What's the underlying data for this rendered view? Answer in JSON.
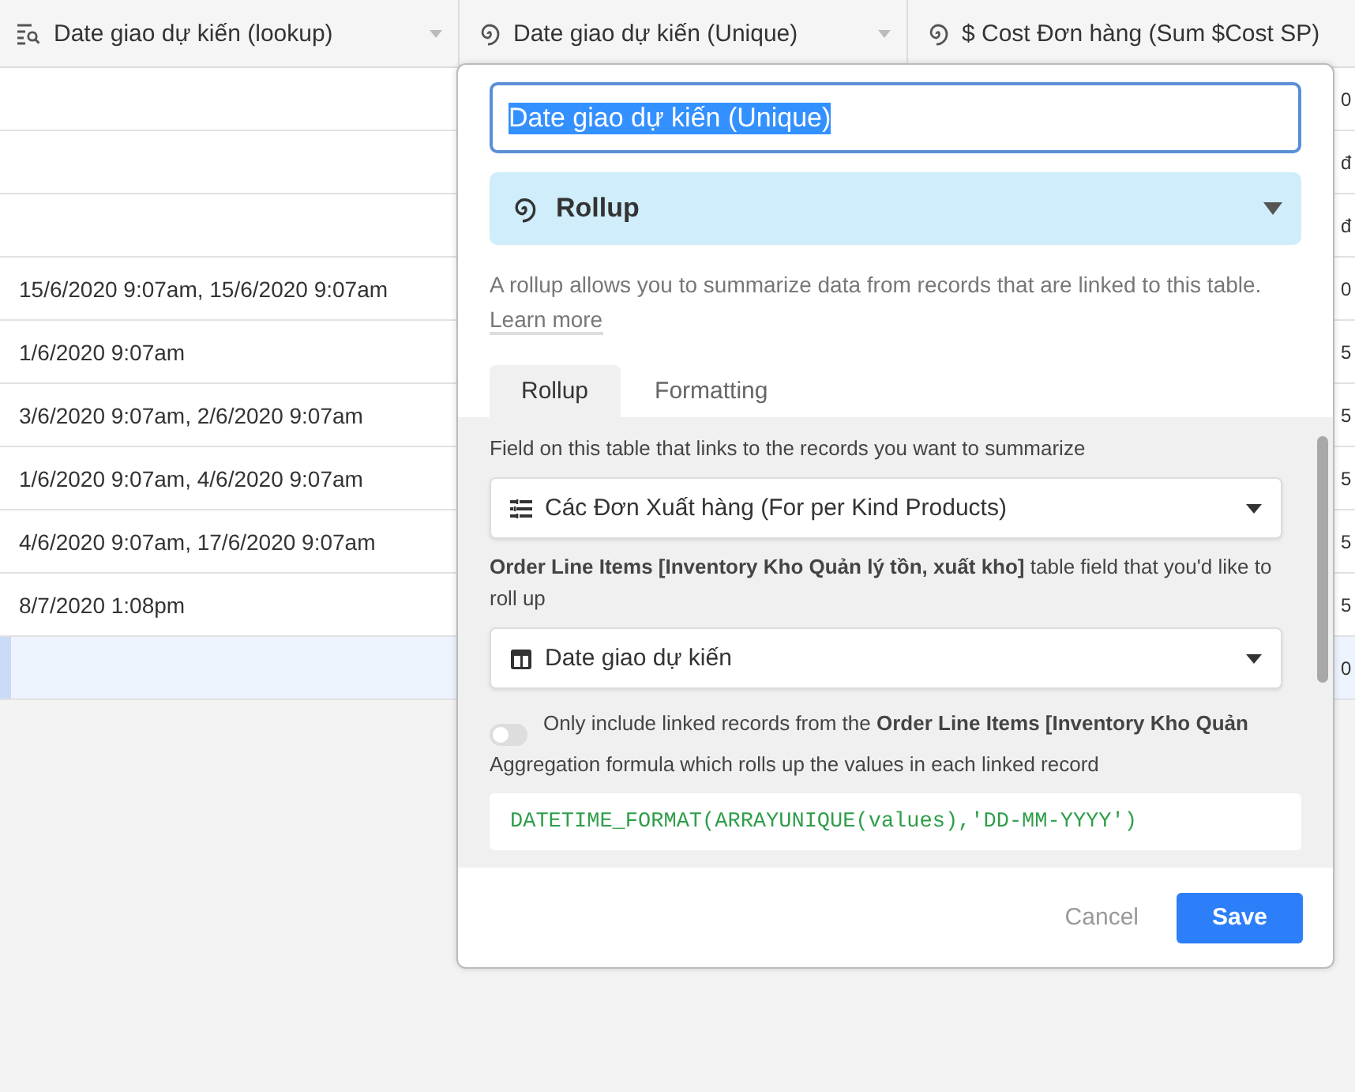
{
  "table": {
    "columns": [
      {
        "label": "Date giao dự kiến (lookup)",
        "kind": "lookup"
      },
      {
        "label": "Date giao dự kiến (Unique)",
        "kind": "rollup"
      },
      {
        "label": "$ Cost Đơn hàng (Sum $Cost SP)",
        "kind": "rollup"
      }
    ],
    "rows": [
      {
        "cells": [
          "",
          "0"
        ],
        "selected": false
      },
      {
        "cells": [
          "",
          "đ"
        ],
        "selected": false
      },
      {
        "cells": [
          "",
          "đ"
        ],
        "selected": false
      },
      {
        "cells": [
          "15/6/2020 9:07am, 15/6/2020 9:07am",
          "0"
        ],
        "selected": false
      },
      {
        "cells": [
          "1/6/2020 9:07am",
          "5"
        ],
        "selected": false
      },
      {
        "cells": [
          "3/6/2020 9:07am, 2/6/2020 9:07am",
          "5"
        ],
        "selected": false
      },
      {
        "cells": [
          "1/6/2020 9:07am, 4/6/2020 9:07am",
          "5"
        ],
        "selected": false
      },
      {
        "cells": [
          "4/6/2020 9:07am, 17/6/2020 9:07am",
          "5"
        ],
        "selected": false
      },
      {
        "cells": [
          "8/7/2020 1:08pm",
          "5"
        ],
        "selected": false
      },
      {
        "cells": [
          "",
          "0"
        ],
        "selected": true
      }
    ]
  },
  "field_editor": {
    "name": "Date giao dự kiến (Unique)",
    "type": "Rollup",
    "description": "A rollup allows you to summarize data from records that are linked to this table.",
    "learn_more": "Learn more",
    "tabs": [
      {
        "label": "Rollup",
        "selected": true
      },
      {
        "label": "Formatting",
        "selected": false
      }
    ],
    "link_label": "Field on this table that links to the records you want to summarize",
    "link_field": "Các Đơn Xuất hàng (For per Kind Products)",
    "rollup_label": "**Order Line Items [Inventory Kho Quản lý tồn, xuất kho]** table field that you'd like to roll up",
    "rollup_field": "Date giao dự kiến",
    "filter_toggle": {
      "label": "Only include linked records from the **Order Line Items [Inventory Kho Quản**",
      "checked": false
    },
    "formula_label": "Aggregation formula which rolls up the values in each linked record",
    "formula": "DATETIME_FORMAT(ARRAYUNIQUE(values),'DD-MM-YYYY')",
    "buttons": [
      {
        "label": "Cancel",
        "kind": "secondary"
      },
      {
        "label": "Save",
        "kind": "primary"
      }
    ]
  }
}
